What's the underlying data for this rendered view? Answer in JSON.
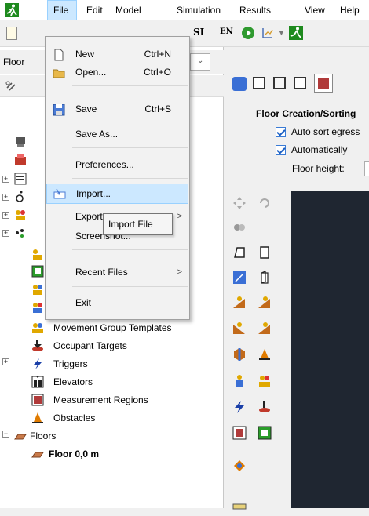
{
  "menubar": {
    "items": [
      "File",
      "Edit",
      "Model",
      "Simulation",
      "Results",
      "View",
      "Help"
    ]
  },
  "toolbar": {
    "unit_si": "SI",
    "unit_en": "EN"
  },
  "left": {
    "floor_label": "Floor",
    "tree": [
      {
        "label": "Movement Group Templates"
      },
      {
        "label": "Occupant Targets"
      },
      {
        "label": "Triggers"
      },
      {
        "label": "Elevators"
      },
      {
        "label": "Measurement Regions"
      },
      {
        "label": "Obstacles"
      },
      {
        "label": "Floors"
      },
      {
        "label": "Floor 0,0 m"
      }
    ]
  },
  "file_menu": {
    "items": [
      {
        "label": "New",
        "accel": "Ctrl+N"
      },
      {
        "label": "Open...",
        "accel": "Ctrl+O"
      },
      {
        "label": "Save",
        "accel": "Ctrl+S"
      },
      {
        "label": "Save As..."
      },
      {
        "label": "Preferences..."
      },
      {
        "label": "Import..."
      },
      {
        "label": "Export..."
      },
      {
        "label": "Screenshot..."
      },
      {
        "label": "Recent Files"
      },
      {
        "label": "Exit"
      }
    ],
    "tooltip": "Import File"
  },
  "right": {
    "header": "Floor Creation/Sorting",
    "opt_autosort": "Auto sort egress",
    "opt_automatically": "Automatically",
    "floor_height_label": "Floor height:"
  },
  "colors": {
    "menu_highlight": "#cce8ff",
    "canvas": "#1f2631",
    "accent_green": "#1e8a1e"
  }
}
